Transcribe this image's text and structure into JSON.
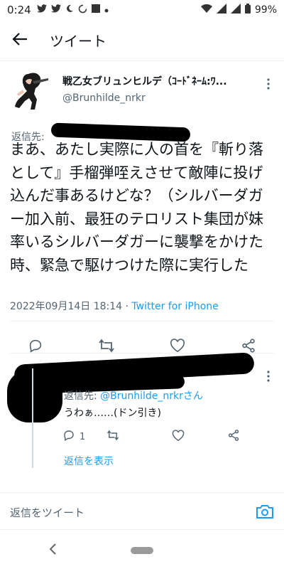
{
  "status_bar": {
    "time": "0:24",
    "battery": "99%"
  },
  "header": {
    "title": "ツイート"
  },
  "tweet": {
    "display_name": "戦乙女ブリュンヒルデ（ｺｰﾄﾞﾈｰﾑ:ﾜ...",
    "handle": "@Brunhilde_nrkr",
    "reply_to_label": "返信先:",
    "text": "まあ、あたし実際に人の首を『斬り落として』手榴弾咥えさせて敵陣に投げ込んだ事あるけどな？（シルバーダガー加入前、最狂のテロリスト集団が妹率いるシルバーダガーに襲撃をかけた時、緊急で駆けつけた際に実行した",
    "date": "2022年09月14日 18:14",
    "separator": " · ",
    "source": "Twitter for iPhone"
  },
  "reply": {
    "reply_to_label": "返信先: ",
    "reply_to_handle": "@Brunhilde_nrkrさん",
    "text": "うわぁ……(ドン引き)",
    "reply_count": "1",
    "show_replies": "返信を表示"
  },
  "compose": {
    "placeholder": "返信をツイート"
  },
  "colors": {
    "accent": "#1d9bf0",
    "secondary_text": "#536471"
  }
}
